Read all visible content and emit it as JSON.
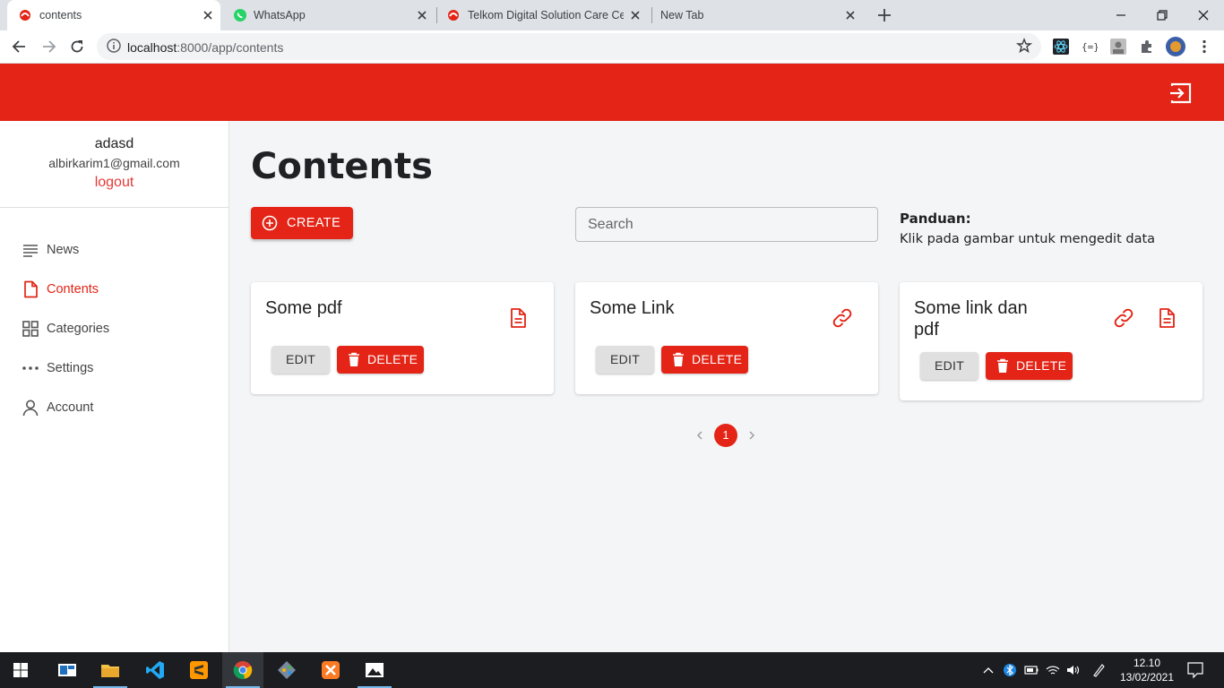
{
  "browser": {
    "tabs": [
      {
        "title": "contents",
        "active": true
      },
      {
        "title": "WhatsApp",
        "active": false
      },
      {
        "title": "Telkom Digital Solution Care Cen",
        "active": false
      },
      {
        "title": "New Tab",
        "active": false
      }
    ],
    "url_host": "localhost",
    "url_path": ":8000/app/contents"
  },
  "sidebar": {
    "user_name": "adasd",
    "user_email": "albirkarim1@gmail.com",
    "logout_label": "logout",
    "items": [
      {
        "label": "News",
        "icon": "list-icon",
        "active": false
      },
      {
        "label": "Contents",
        "icon": "document-icon",
        "active": true
      },
      {
        "label": "Categories",
        "icon": "grid-icon",
        "active": false
      },
      {
        "label": "Settings",
        "icon": "more-dots-icon",
        "active": false
      },
      {
        "label": "Account",
        "icon": "person-icon",
        "active": false
      }
    ]
  },
  "main": {
    "title": "Contents",
    "create_label": "CREATE",
    "search_placeholder": "Search",
    "guide_title": "Panduan:",
    "guide_text": "Klik pada gambar untuk mengedit data",
    "cards": [
      {
        "title": "Some pdf",
        "icons": [
          "document-icon"
        ],
        "edit_label": "EDIT",
        "delete_label": "DELETE"
      },
      {
        "title": "Some Link",
        "icons": [
          "link-icon"
        ],
        "edit_label": "EDIT",
        "delete_label": "DELETE"
      },
      {
        "title": "Some link dan pdf",
        "icons": [
          "link-icon",
          "document-icon"
        ],
        "edit_label": "EDIT",
        "delete_label": "DELETE"
      }
    ],
    "pagination": {
      "current_page": "1"
    }
  },
  "taskbar": {
    "time": "12.10",
    "date": "13/02/2021"
  },
  "colors": {
    "accent": "#e32416",
    "background": "#f4f5f7"
  }
}
